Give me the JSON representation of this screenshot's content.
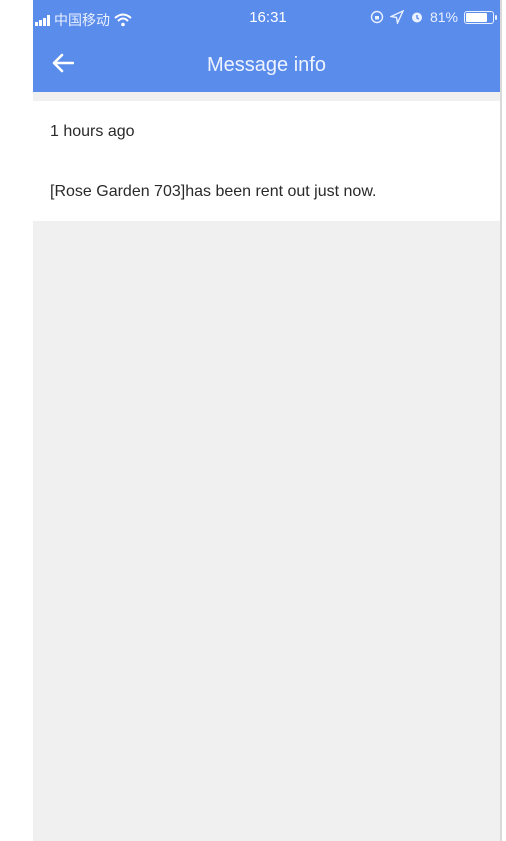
{
  "status_bar": {
    "carrier": "中国移动",
    "time": "16:31",
    "battery_text": "81%",
    "battery_level": 0.81,
    "icons": [
      "signal-icon",
      "wifi-icon",
      "lock-rotation-icon",
      "location-icon",
      "alarm-icon",
      "battery-icon"
    ]
  },
  "header": {
    "title": "Message info",
    "back_icon": "back-arrow-icon",
    "background_color": "#5a8cec"
  },
  "message": {
    "time": "1 hours ago",
    "text": "[Rose Garden 703]has been rent out just now."
  }
}
